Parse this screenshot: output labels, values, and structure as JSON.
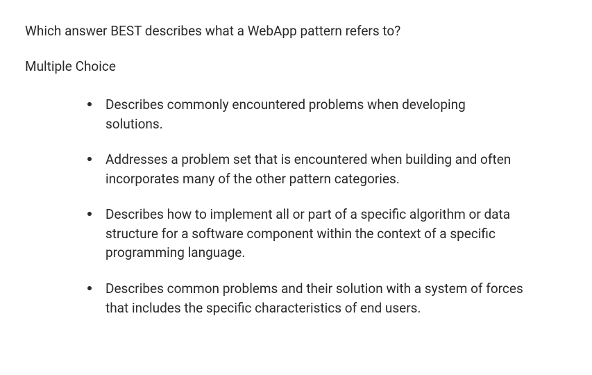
{
  "question": "Which answer BEST describes what a WebApp pattern refers to?",
  "subtitle": "Multiple Choice",
  "options": [
    {
      "text": "Describes commonly encountered problems when developing solutions."
    },
    {
      "text": "Addresses a problem set that is encountered when building and often incorporates many of the other pattern categories."
    },
    {
      "text": "Describes how to implement all or part of a specific algorithm or data structure for a software component within the context of a specific programming language."
    },
    {
      "text": "Describes common problems and their solution with a system of forces that includes the specific characteristics of end users."
    }
  ]
}
